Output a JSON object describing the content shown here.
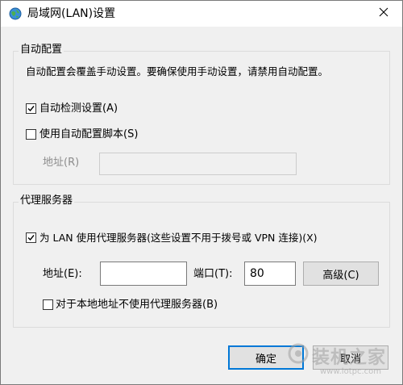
{
  "window": {
    "title": "局域网(LAN)设置"
  },
  "auto_config": {
    "group_label": "自动配置",
    "description": "自动配置会覆盖手动设置。要确保使用手动设置，请禁用自动配置。",
    "auto_detect": {
      "label": "自动检测设置(A)",
      "checked": true
    },
    "use_script": {
      "label": "使用自动配置脚本(S)",
      "checked": false
    },
    "address_label": "地址(R)",
    "address_value": ""
  },
  "proxy": {
    "group_label": "代理服务器",
    "use_proxy": {
      "label": "为 LAN 使用代理服务器(这些设置不用于拨号或 VPN 连接)(X)",
      "checked": true
    },
    "address_label": "地址(E):",
    "address_value": "",
    "port_label": "端口(T):",
    "port_value": "80",
    "advanced_label": "高级(C)",
    "bypass_local": {
      "label": "对于本地地址不使用代理服务器(B)",
      "checked": false
    }
  },
  "footer": {
    "ok_label": "确定",
    "cancel_label": "取消"
  },
  "watermark": {
    "text": "装机之家",
    "url": "www.lotpc.com"
  },
  "colors": {
    "accent": "#0078d7",
    "window_bg": "#f0f0f0",
    "disabled_text": "#8c8c8c"
  },
  "icons": {
    "title": "globe-network-icon",
    "close": "close-icon",
    "check": "checkmark-icon"
  }
}
